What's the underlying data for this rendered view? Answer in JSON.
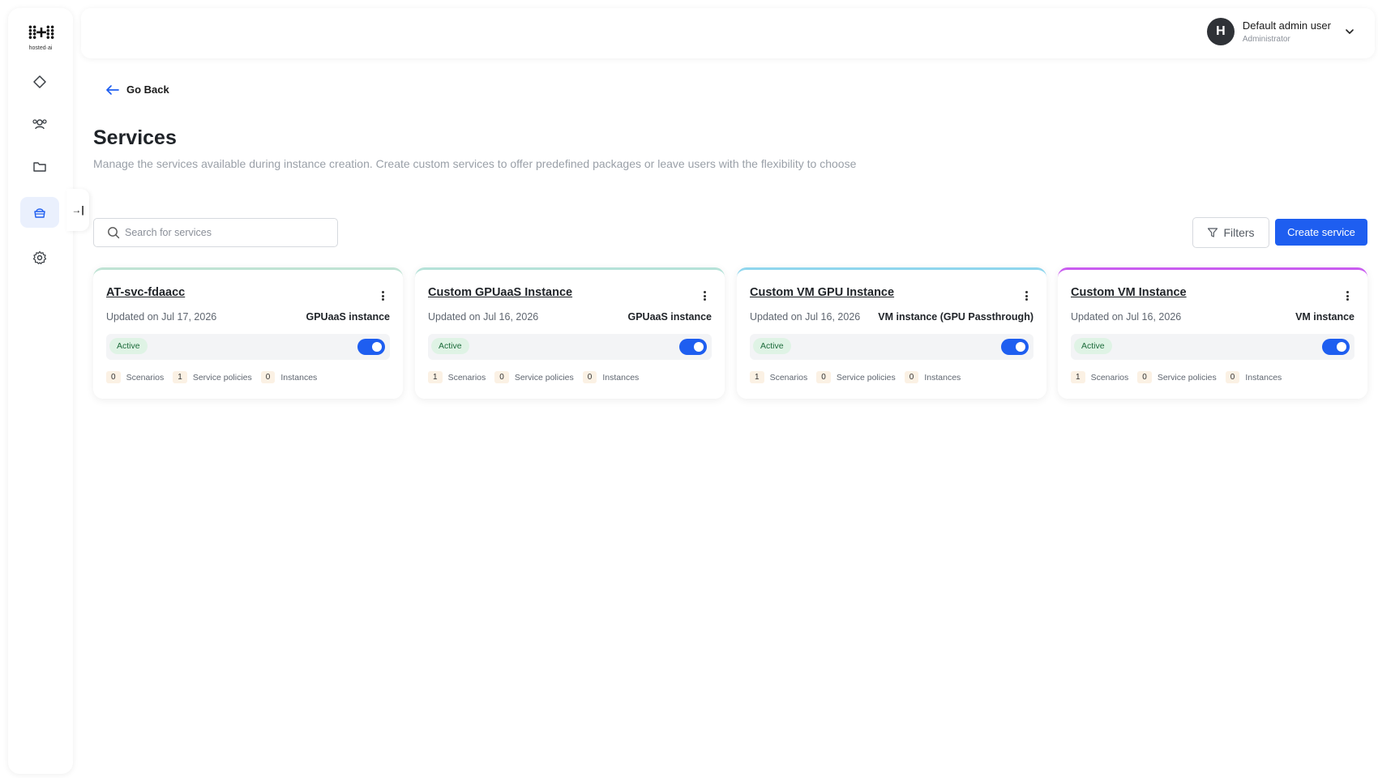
{
  "brand": {
    "logo_mark": "⁞⁞+⁞⁞",
    "logo_text": "hosted·ai"
  },
  "sidebar": {
    "items": [
      {
        "icon": "diamond-icon"
      },
      {
        "icon": "users-icon"
      },
      {
        "icon": "folder-icon"
      },
      {
        "icon": "services-icon",
        "active": true
      },
      {
        "icon": "gear-icon"
      }
    ],
    "collapse_glyph": "→|"
  },
  "header": {
    "avatar_initial": "H",
    "user_name": "Default admin user",
    "user_role": "Administrator"
  },
  "nav": {
    "go_back": "Go Back"
  },
  "page": {
    "title": "Services",
    "subtitle": "Manage the services available during instance creation. Create custom services to offer predefined packages or leave users with the flexibility to choose"
  },
  "search": {
    "placeholder": "Search for services"
  },
  "toolbar": {
    "filters_label": "Filters",
    "create_label": "Create service"
  },
  "colors": {
    "accent": "#1e5ef0",
    "card_borders": [
      "#bfe3d4",
      "#b5e2d8",
      "#8fd6ee",
      "#c95cf0"
    ]
  },
  "cards": [
    {
      "title": "AT-svc-fdaacc",
      "updated": "Updated on Jul 17, 2026",
      "type": "GPUaaS instance",
      "status": "Active",
      "stats": [
        {
          "value": "0",
          "label": "Scenarios"
        },
        {
          "value": "1",
          "label": "Service policies"
        },
        {
          "value": "0",
          "label": "Instances"
        }
      ]
    },
    {
      "title": "Custom GPUaaS Instance",
      "updated": "Updated on Jul 16, 2026",
      "type": "GPUaaS instance",
      "status": "Active",
      "stats": [
        {
          "value": "1",
          "label": "Scenarios"
        },
        {
          "value": "0",
          "label": "Service policies"
        },
        {
          "value": "0",
          "label": "Instances"
        }
      ]
    },
    {
      "title": "Custom VM GPU Instance",
      "updated": "Updated on Jul 16, 2026",
      "type": "VM instance (GPU Passthrough)",
      "status": "Active",
      "stats": [
        {
          "value": "1",
          "label": "Scenarios"
        },
        {
          "value": "0",
          "label": "Service policies"
        },
        {
          "value": "0",
          "label": "Instances"
        }
      ]
    },
    {
      "title": "Custom VM Instance",
      "updated": "Updated on Jul 16, 2026",
      "type": "VM instance",
      "status": "Active",
      "stats": [
        {
          "value": "1",
          "label": "Scenarios"
        },
        {
          "value": "0",
          "label": "Service policies"
        },
        {
          "value": "0",
          "label": "Instances"
        }
      ]
    }
  ]
}
